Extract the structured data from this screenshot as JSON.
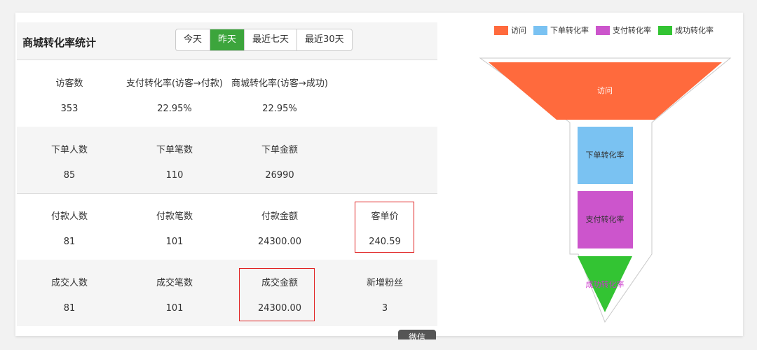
{
  "panel": {
    "title": "商城转化率统计",
    "tabs": [
      {
        "label": "今天",
        "active": false
      },
      {
        "label": "昨天",
        "active": true
      },
      {
        "label": "最近七天",
        "active": false
      },
      {
        "label": "最近30天",
        "active": false
      }
    ],
    "rows": [
      [
        {
          "label": "访客数",
          "value": "353"
        },
        {
          "label": "支付转化率(访客→付款)",
          "value": "22.95%"
        },
        {
          "label": "商城转化率(访客→成功)",
          "value": "22.95%"
        }
      ],
      [
        {
          "label": "下单人数",
          "value": "85"
        },
        {
          "label": "下单笔数",
          "value": "110"
        },
        {
          "label": "下单金额",
          "value": "26990"
        }
      ],
      [
        {
          "label": "付款人数",
          "value": "81"
        },
        {
          "label": "付款笔数",
          "value": "101"
        },
        {
          "label": "付款金额",
          "value": "24300.00"
        },
        {
          "label": "客单价",
          "value": "240.59"
        }
      ],
      [
        {
          "label": "成交人数",
          "value": "81"
        },
        {
          "label": "成交笔数",
          "value": "101"
        },
        {
          "label": "成交金额",
          "value": "24300.00"
        },
        {
          "label": "新增粉丝",
          "value": "3"
        }
      ]
    ],
    "floating_button_label": "微信"
  },
  "colors": {
    "active_tab": "#3ca53c",
    "highlight": "#e02020",
    "visit": "#ff6a3d",
    "order": "#7ac2f2",
    "pay": "#cc55cc",
    "success": "#33c433"
  },
  "chart_data": {
    "type": "funnel",
    "legend_position": "top",
    "series": [
      {
        "name": "访问",
        "color": "#ff6a3d"
      },
      {
        "name": "下单转化率",
        "color": "#7ac2f2"
      },
      {
        "name": "支付转化率",
        "color": "#cc55cc"
      },
      {
        "name": "成功转化率",
        "color": "#33c433"
      }
    ]
  }
}
